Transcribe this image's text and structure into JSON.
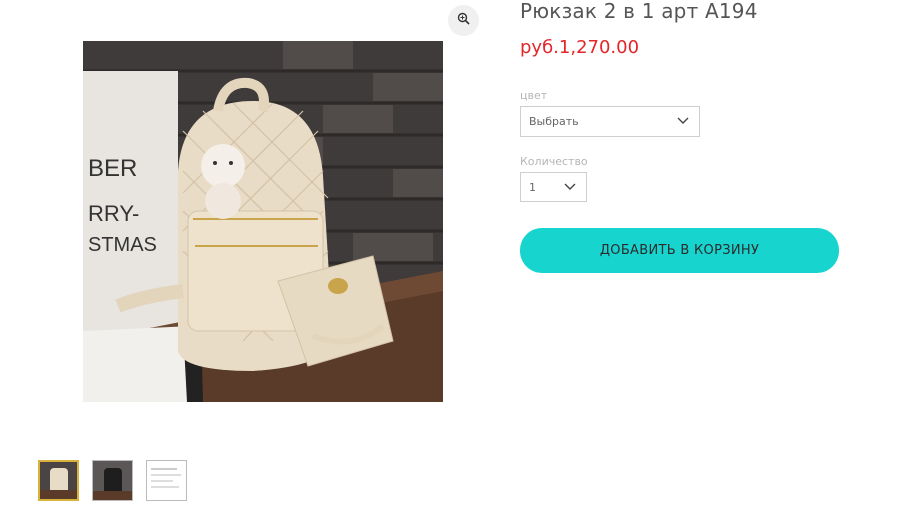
{
  "gallery": {
    "zoom_icon": "magnifier-icon",
    "main_image": "beige quilted backpack with bear charm and pouch",
    "thumbnails": [
      "beige backpack",
      "black backpack",
      "white document"
    ],
    "active_index": 0
  },
  "product": {
    "title": "Рюкзак 2 в 1 арт A194",
    "price": "руб.1,270.00",
    "color_label": "цвет",
    "color_value": "Выбрать",
    "quantity_label": "Количество",
    "quantity_value": "1",
    "add_to_cart_label": "ДОБАВИТЬ В КОРЗИНУ"
  },
  "colors": {
    "price": "#e4262b",
    "button": "#17d4cf",
    "thumb_active_border": "#d8b23a"
  }
}
